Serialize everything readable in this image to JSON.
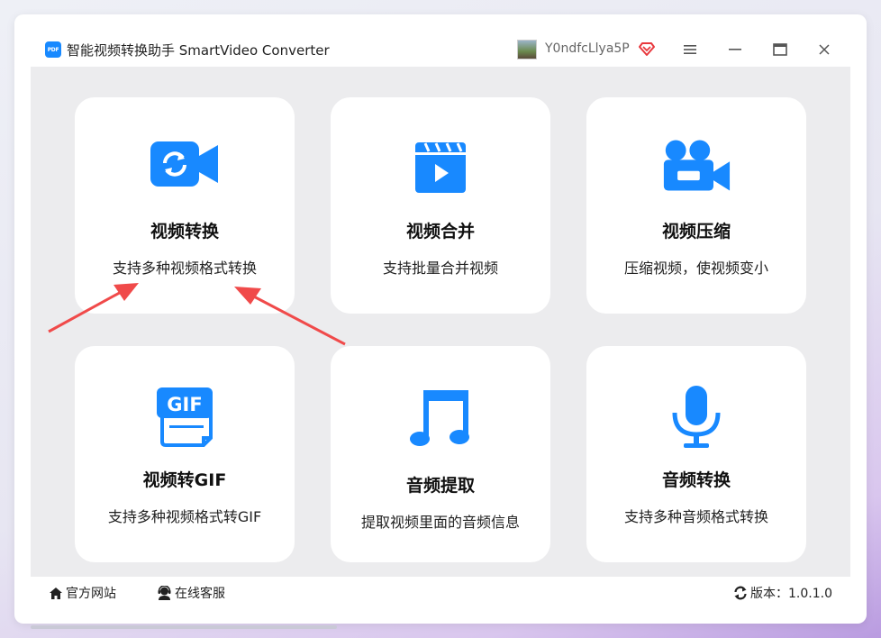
{
  "window": {
    "title": "智能视频转换助手 SmartVideo Converter",
    "logo_text": "PDF",
    "user": "Y0ndfcLlya5P"
  },
  "cards": [
    {
      "title": "视频转换",
      "desc": "支持多种视频格式转换",
      "icon": "video-convert-icon"
    },
    {
      "title": "视频合并",
      "desc": "支持批量合并视频",
      "icon": "clapperboard-icon"
    },
    {
      "title": "视频压缩",
      "desc": "压缩视频，使视频变小",
      "icon": "movie-camera-icon"
    },
    {
      "title": "视频转GIF",
      "desc": "支持多种视频格式转GIF",
      "icon": "gif-file-icon",
      "icon_text": "GIF"
    },
    {
      "title": "音频提取",
      "desc": "提取视频里面的音频信息",
      "icon": "music-note-icon"
    },
    {
      "title": "音频转换",
      "desc": "支持多种音频格式转换",
      "icon": "microphone-icon"
    }
  ],
  "footer": {
    "website": "官方网站",
    "support": "在线客服",
    "version": "版本：1.0.1.0"
  },
  "colors": {
    "accent": "#1889ff",
    "arrow": "#f04a4a",
    "vip": "#e8383d"
  }
}
